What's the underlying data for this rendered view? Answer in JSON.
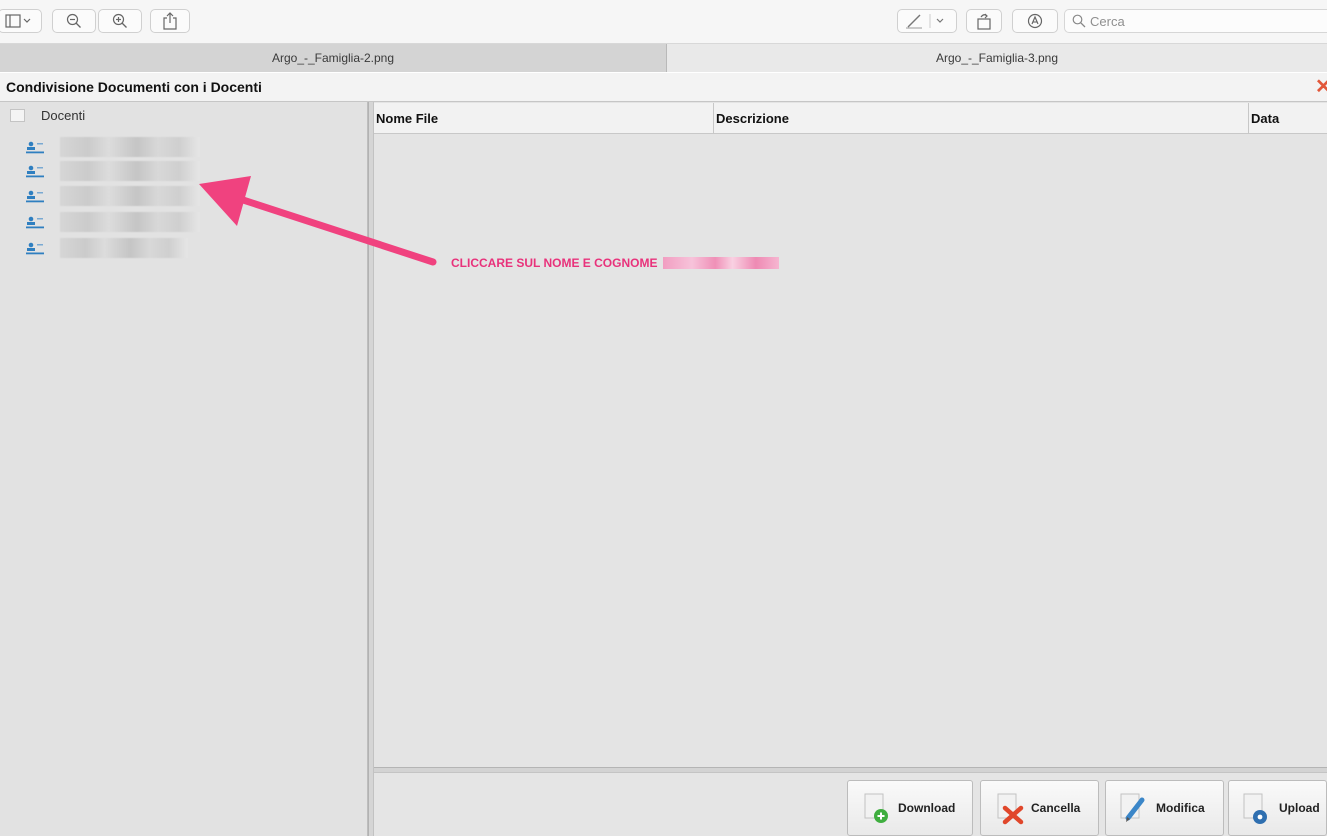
{
  "toolbar": {
    "search_placeholder": "Cerca"
  },
  "tabs": [
    {
      "label": "Argo_-_Famiglia-2.png",
      "active": false
    },
    {
      "label": "Argo_-_Famiglia-3.png",
      "active": true
    }
  ],
  "app": {
    "title": "Condivisione Documenti con i Docenti"
  },
  "tree": {
    "root_label": "Docenti",
    "item_count": 5
  },
  "grid": {
    "columns": [
      "Nome File",
      "Descrizione",
      "Data"
    ]
  },
  "actions": {
    "download_label": "Download",
    "cancella_label": "Cancella",
    "modifica_label": "Modifica",
    "upload_label": "Upload"
  },
  "annotation": {
    "text": "CLICCARE SUL NOME E COGNOME",
    "color": "#e8327b"
  },
  "colors": {
    "accent_pink": "#e8327b",
    "close_red": "#e2573a",
    "user_icon_blue": "#2f7fc0"
  }
}
